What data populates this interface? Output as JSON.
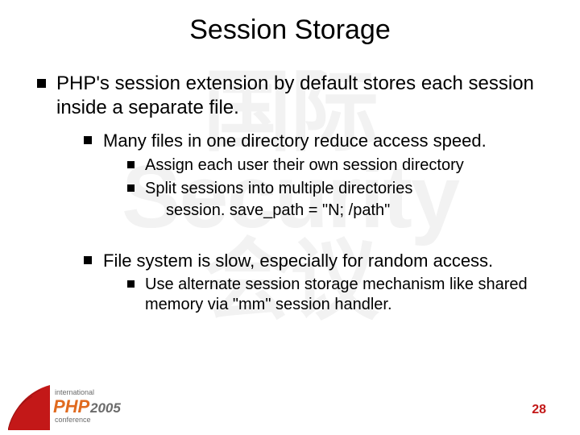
{
  "watermark": "国际\nSecurity\n会议",
  "title": "Session Storage",
  "bullets": {
    "l1_0": "PHP's session extension by default stores each session inside a separate file.",
    "l2_0": "Many files in one directory reduce access speed.",
    "l3_0": "Assign each user their own session directory",
    "l3_1": "Split sessions into multiple directories",
    "code_0": "session. save_path = \"N; /path\"",
    "l2_1": "File system is slow, especially for random access.",
    "l3_2": "Use alternate session storage mechanism like shared memory via \"mm\" session handler."
  },
  "page_number": "28",
  "logo": {
    "top": "international",
    "brand": "PHP",
    "year": "2005",
    "bottom": "conference"
  },
  "colors": {
    "accent": "#c31818",
    "logo_orange": "#e06a1f",
    "logo_gray": "#6b6b6b"
  }
}
